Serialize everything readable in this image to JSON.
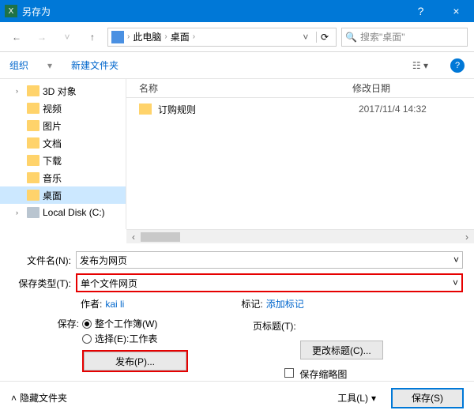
{
  "titlebar": {
    "title": "另存为"
  },
  "nav": {
    "breadcrumb": {
      "pc": "此电脑",
      "desktop": "桌面"
    },
    "search_placeholder": "搜索\"桌面\""
  },
  "toolbar": {
    "organize": "组织",
    "newfolder": "新建文件夹"
  },
  "tree": [
    {
      "name": "3D 对象",
      "expandable": true
    },
    {
      "name": "视频",
      "expandable": false
    },
    {
      "name": "图片",
      "expandable": false
    },
    {
      "name": "文档",
      "expandable": false
    },
    {
      "name": "下载",
      "expandable": false
    },
    {
      "name": "音乐",
      "expandable": false
    },
    {
      "name": "桌面",
      "expandable": false,
      "selected": true
    },
    {
      "name": "Local Disk (C:)",
      "expandable": true,
      "disk": true
    }
  ],
  "list": {
    "headers": {
      "name": "名称",
      "date": "修改日期"
    },
    "rows": [
      {
        "name": "订购规则",
        "date": "2017/11/4 14:32"
      }
    ]
  },
  "form": {
    "filename_label": "文件名(N):",
    "filename_value": "发布为网页",
    "filetype_label": "保存类型(T):",
    "filetype_value": "单个文件网页",
    "author_label": "作者:",
    "author_value": "kai li",
    "tags_label": "标记:",
    "tags_value": "添加标记",
    "save_label": "保存:",
    "radio1": "整个工作簿(W)",
    "radio2": "选择(E):工作表",
    "pagetitle_label": "页标题(T):",
    "pagetitle_value": "",
    "changetitle_btn": "更改标题(C)...",
    "publish_btn": "发布(P)...",
    "save_thumbnail": "保存缩略图"
  },
  "footer": {
    "hide_folders": "隐藏文件夹",
    "tools": "工具(L)",
    "save": "保存(S)"
  }
}
